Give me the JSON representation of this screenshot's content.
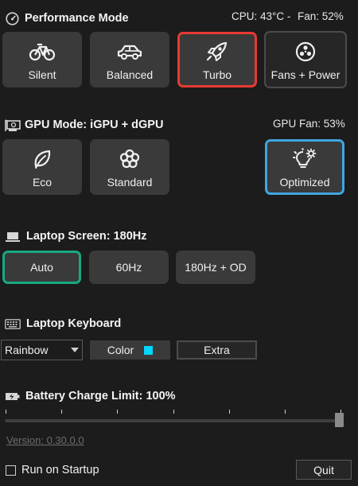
{
  "performance": {
    "title": "Performance Mode",
    "status_cpu": "CPU: 43°C -",
    "status_fan": "Fan: 52%",
    "modes": [
      {
        "label": "Silent",
        "icon": "bicycle-icon"
      },
      {
        "label": "Balanced",
        "icon": "car-icon"
      },
      {
        "label": "Turbo",
        "icon": "rocket-icon",
        "selected": true
      },
      {
        "label": "Fans + Power",
        "icon": "fan-icon"
      }
    ]
  },
  "gpu": {
    "title": "GPU Mode: iGPU + dGPU",
    "status": "GPU Fan: 53%",
    "modes": [
      {
        "label": "Eco",
        "icon": "leaf-icon"
      },
      {
        "label": "Standard",
        "icon": "flower-icon"
      },
      {
        "label": "Optimized",
        "icon": "bulb-gear-icon",
        "selected": true
      }
    ]
  },
  "screen": {
    "title": "Laptop Screen: 180Hz",
    "modes": [
      {
        "label": "Auto",
        "selected": true
      },
      {
        "label": "60Hz"
      },
      {
        "label": "180Hz + OD"
      }
    ]
  },
  "keyboard": {
    "title": "Laptop Keyboard",
    "mode_selected": "Rainbow",
    "color_label": "Color",
    "extra_label": "Extra",
    "swatch_color": "#00d7ff"
  },
  "battery": {
    "title": "Battery Charge Limit: 100%",
    "limit_fraction": 1.0
  },
  "footer": {
    "version": "Version: 0.30.0.0",
    "startup_label": "Run on Startup",
    "startup_checked": false,
    "quit_label": "Quit"
  },
  "colors": {
    "turbo_border": "#e83a33",
    "optimized_border": "#3fa6e0",
    "auto_border": "#17a981"
  }
}
